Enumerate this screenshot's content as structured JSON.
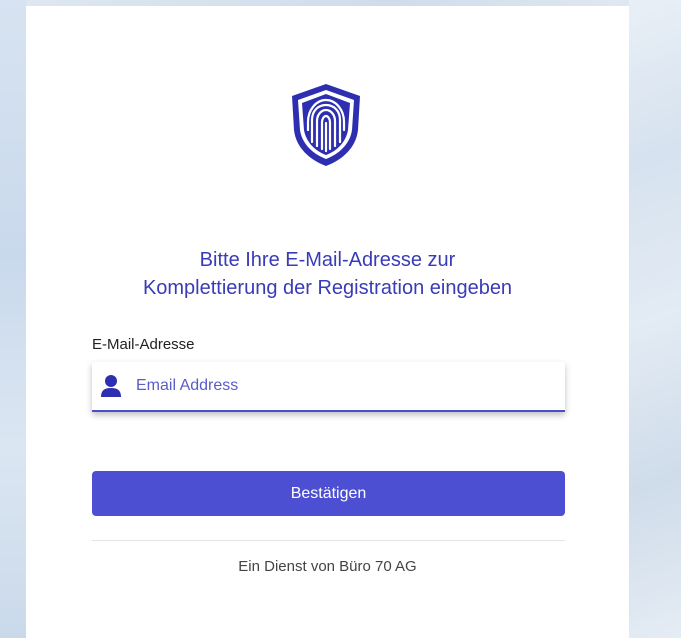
{
  "heading": {
    "line1": "Bitte Ihre E-Mail-Adresse zur",
    "line2": "Komplettierung der Registration eingeben"
  },
  "email": {
    "label": "E-Mail-Adresse",
    "placeholder": "Email Address",
    "value": "",
    "icon": "user-icon"
  },
  "submit": {
    "label": "Bestätigen"
  },
  "footer": {
    "text": "Ein Dienst von Büro 70 AG"
  },
  "colors": {
    "accent": "#4c4fd2",
    "heading": "#3a3bb8",
    "logo": "#2d2fb0"
  },
  "logo": {
    "icon": "fingerprint-shield-icon"
  }
}
